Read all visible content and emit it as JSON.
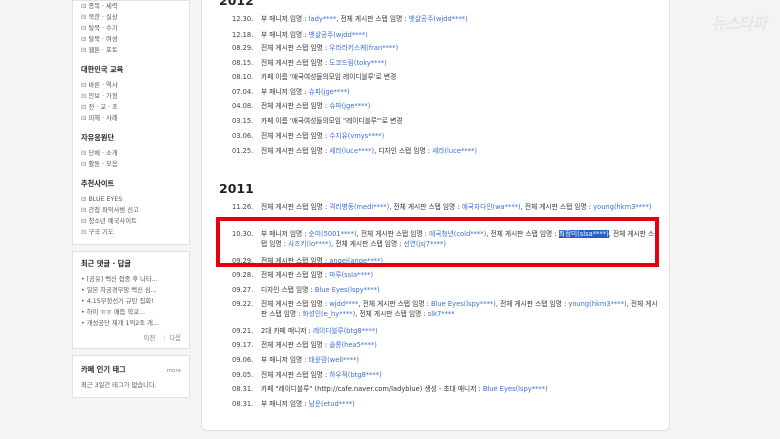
{
  "sidebar": {
    "top_links": [
      "종목 · 세력",
      "북한 · 실상",
      "탈북 · 수기",
      "탈북 · 여성",
      "웹툰 · 포토"
    ],
    "section2_title": "대한민국 교육",
    "section2_links": [
      "바른 · 역사",
      "안보 · 가정",
      "전 · 교 · 조",
      "피해 · 사례"
    ],
    "section3_title": "자유응원단",
    "section3_links": [
      "단체 · 소개",
      "활동 · 모음"
    ],
    "section4_title": "추천사이트",
    "section4_links": [
      "BLUE EYES",
      "간첩 좌익사범 신고",
      "청소년 예국사이트",
      "구국 기도"
    ],
    "comments_title": "최근 댓글 · 답글",
    "comments": [
      "• [공유] 백신 접종 후 나타...",
      "• 일본 자궁경부암 백신 심...",
      "• 4.15부정선거 규탄 집회!",
      "• 하이 ㅠㅠ 매듭 학교...",
      "• 개성공단 재개 1억2조 개..."
    ],
    "pager_prev": "이전",
    "pager_next": "다음",
    "tags_title": "카페 인기 태그",
    "tags_more": "more",
    "tags_text": "최근 3일간 태그가 없습니다."
  },
  "year_2012": "2012",
  "rows_2012": [
    {
      "date": "12.30.",
      "parts": [
        [
          "부 매니저 임명 : ",
          ""
        ],
        [
          "lady****",
          "blue"
        ],
        [
          ", 전체 게시판 스탭 임명 : ",
          ""
        ],
        [
          "뱃샬공주(wjdd****)",
          "blue"
        ]
      ]
    },
    {
      "date": "12.18.",
      "parts": [
        [
          "부 매니저 임명 : ",
          ""
        ],
        [
          "뱃샬공주(wjdd****)",
          "blue"
        ]
      ]
    },
    {
      "date": "08.29.",
      "parts": [
        [
          "전체 게시판 스탭 임명 : ",
          ""
        ],
        [
          "우라라키스케(fran****)",
          "blue"
        ]
      ]
    },
    {
      "date": "08.15.",
      "parts": [
        [
          "전체 게시판 스탭 임명 : ",
          ""
        ],
        [
          "도코드림(toky****)",
          "blue"
        ]
      ]
    },
    {
      "date": "08.10.",
      "parts": [
        [
          "카페 이름 '애국여성들의모임 레이디블루'로 변경",
          ""
        ]
      ]
    },
    {
      "date": "07.04.",
      "parts": [
        [
          "부 매니저 임명 : ",
          ""
        ],
        [
          "슈파(jge****)",
          "blue"
        ]
      ]
    },
    {
      "date": "04.08.",
      "parts": [
        [
          "전체 게시판 스탭 임명 : ",
          ""
        ],
        [
          "슈파(jge****)",
          "blue"
        ]
      ]
    },
    {
      "date": "03.15.",
      "parts": [
        [
          "카페 이름 '애국여성들의모임 \"레이디블루\"'로 변경",
          ""
        ]
      ]
    },
    {
      "date": "03.06.",
      "parts": [
        [
          "전체 게시판 스탭 임명 : ",
          ""
        ],
        [
          "수지유(vmys****)",
          "blue"
        ]
      ]
    },
    {
      "date": "01.25.",
      "parts": [
        [
          "전체 게시판 스탭 임명 : ",
          ""
        ],
        [
          "세라(luce****)",
          "blue"
        ],
        [
          ", 디자인 스탭 임명 : ",
          ""
        ],
        [
          "세라(luce****)",
          "blue"
        ]
      ]
    }
  ],
  "year_2011": "2011",
  "rows_2011": [
    {
      "date": "11.26.",
      "parts": [
        [
          "전체 게시판 스탭 임명 : ",
          ""
        ],
        [
          "격리병동(medi****)",
          "blue"
        ],
        [
          ", 전체 게시판 스탭 임명 : ",
          ""
        ],
        [
          "애국자다인(wa****)",
          "blue"
        ],
        [
          ", 전체 게시판 스탭 임명 : ",
          ""
        ],
        [
          "young(hkm3****)",
          "blue"
        ]
      ]
    },
    {
      "date": "10.30.",
      "parts": [
        [
          "부 매니저 임명 : ",
          ""
        ],
        [
          "순미(5001****)",
          "blue"
        ],
        [
          ", 전체 게시판 스탭 임명 : ",
          ""
        ],
        [
          "애국청년(cold****)",
          "blue"
        ],
        [
          ", 전체 게시판 스탭 임명 : ",
          ""
        ],
        [
          "최정미(slsa****)",
          "hl"
        ],
        [
          ", 전체 게시판 스탭 임명 : ",
          ""
        ],
        [
          "사즈키(lo****)",
          "blue"
        ],
        [
          ", 전체 게시판 스탭 임명 : ",
          ""
        ],
        [
          "선연(jsj7****)",
          "blue"
        ]
      ]
    },
    {
      "date": "09.29.",
      "parts": [
        [
          "전체 게시판 스탭 임명 : ",
          ""
        ],
        [
          "angel(ange****)",
          "blue"
        ]
      ]
    },
    {
      "date": "09.28.",
      "parts": [
        [
          "전체 게시판 스탭 임명 : ",
          ""
        ],
        [
          "마루(ssla****)",
          "blue"
        ]
      ]
    },
    {
      "date": "09.27.",
      "parts": [
        [
          "디자인 스탭 임명 : ",
          ""
        ],
        [
          "Blue Eyes(lspy****)",
          "blue"
        ]
      ]
    },
    {
      "date": "09.22.",
      "parts": [
        [
          "전체 게시판 스탭 임명 : ",
          ""
        ],
        [
          "wjdd****",
          "blue"
        ],
        [
          ", 전체 게시판 스탭 임명 : ",
          ""
        ],
        [
          "Blue Eyes(lspy****)",
          "blue"
        ],
        [
          ", 전체 게시판 스탭 임명 : ",
          ""
        ],
        [
          "young(hkm3****)",
          "blue"
        ],
        [
          ", 전체 게시판 스탭 임명 : ",
          ""
        ],
        [
          "화성인(e_hy****)",
          "blue"
        ],
        [
          ", 전체 게시판 스탭 임명 : ",
          ""
        ],
        [
          "slk7****",
          "blue"
        ]
      ]
    },
    {
      "date": "09.21.",
      "parts": [
        [
          "2대 카페 매니저 : ",
          ""
        ],
        [
          "레이디블루(btg8****)",
          "blue"
        ]
      ]
    },
    {
      "date": "09.17.",
      "parts": [
        [
          "전체 게시판 스탭 임명 : ",
          ""
        ],
        [
          "솔롱(hea5****)",
          "blue"
        ]
      ]
    },
    {
      "date": "09.06.",
      "parts": [
        [
          "부 매니저 임명 : ",
          ""
        ],
        [
          "태윤맘(well****)",
          "blue"
        ]
      ]
    },
    {
      "date": "09.05.",
      "parts": [
        [
          "전체 게시판 스탭 임명 : ",
          ""
        ],
        [
          "하우적(btg8****)",
          "blue"
        ]
      ]
    },
    {
      "date": "08.31.",
      "parts": [
        [
          "카페 \"레이디블루\" (http://cafe.naver.com/ladyblue) 생성 - 초대 매니저 : ",
          ""
        ],
        [
          "Blue Eyes(lspy****)",
          "blue"
        ]
      ]
    },
    {
      "date": "08.31.",
      "parts": [
        [
          "부 매니저 임명 : ",
          ""
        ],
        [
          "남운(etud****)",
          "blue"
        ]
      ]
    }
  ],
  "watermark": "뉴스타파"
}
